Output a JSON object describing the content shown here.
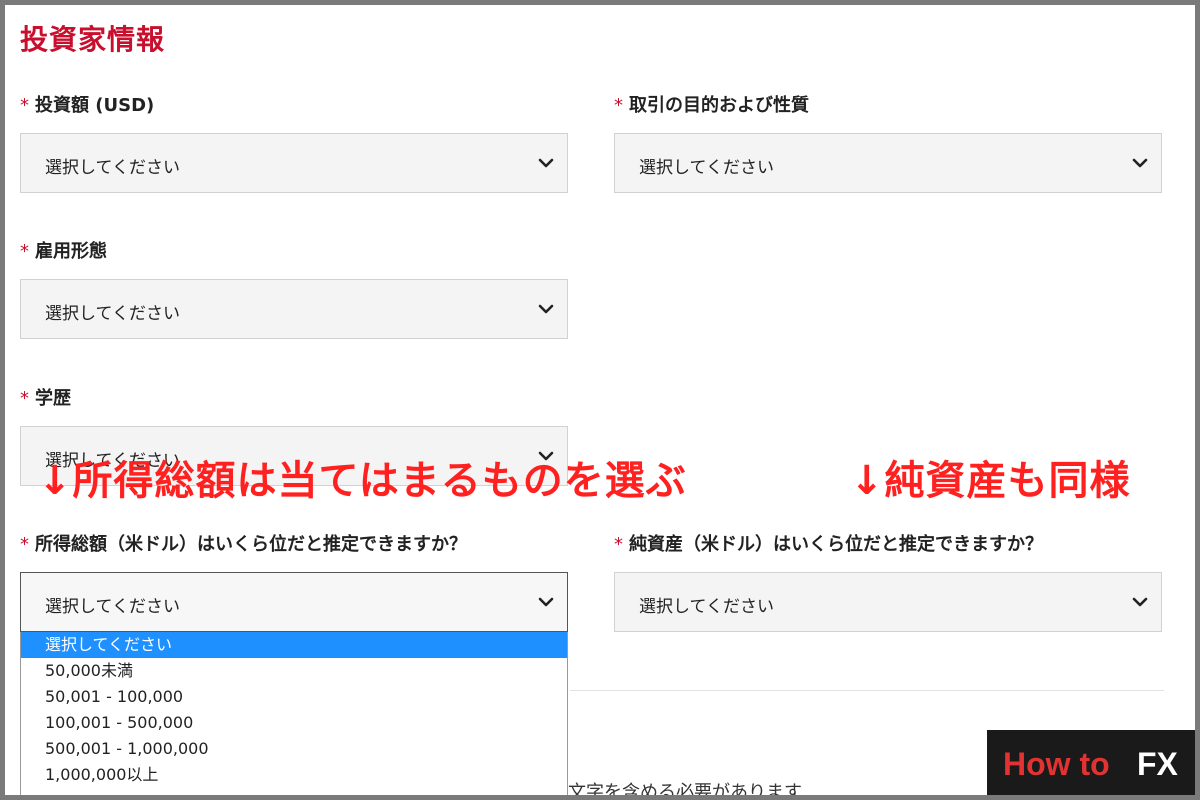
{
  "section_title": "投資家情報",
  "required_mark": "*",
  "fields": {
    "investment": {
      "label": "投資額 (USD)",
      "value": "選択してください"
    },
    "purpose": {
      "label": "取引の目的および性質",
      "value": "選択してください"
    },
    "employment": {
      "label": "雇用形態",
      "value": "選択してください"
    },
    "education": {
      "label": "学歴",
      "value": "選択してください"
    },
    "income": {
      "label": "所得総額（米ドル）はいくら位だと推定できますか？",
      "value": "選択してください"
    },
    "net_assets": {
      "label": "純資産（米ドル）はいくら位だと推定できますか？",
      "value": "選択してください"
    }
  },
  "income_dropdown": {
    "options": [
      "選択してください",
      "50,000未満",
      "50,001 - 100,000",
      "100,001 - 500,000",
      "500,001 - 1,000,000",
      "1,000,000以上"
    ],
    "highlighted_index": 0
  },
  "annotations": {
    "left": "↓所得総額は当てはまるものを選ぶ",
    "right": "↓純資産も同様"
  },
  "partial_text": "文字を含める必要があります",
  "logo": {
    "part1": "How to",
    "part2": "FX"
  },
  "icons": {
    "select_arrow": "chevron-down-icon"
  },
  "colors": {
    "accent_red": "#c8102e",
    "annotation_red": "#ff2020",
    "highlight_blue": "#1e90ff"
  }
}
